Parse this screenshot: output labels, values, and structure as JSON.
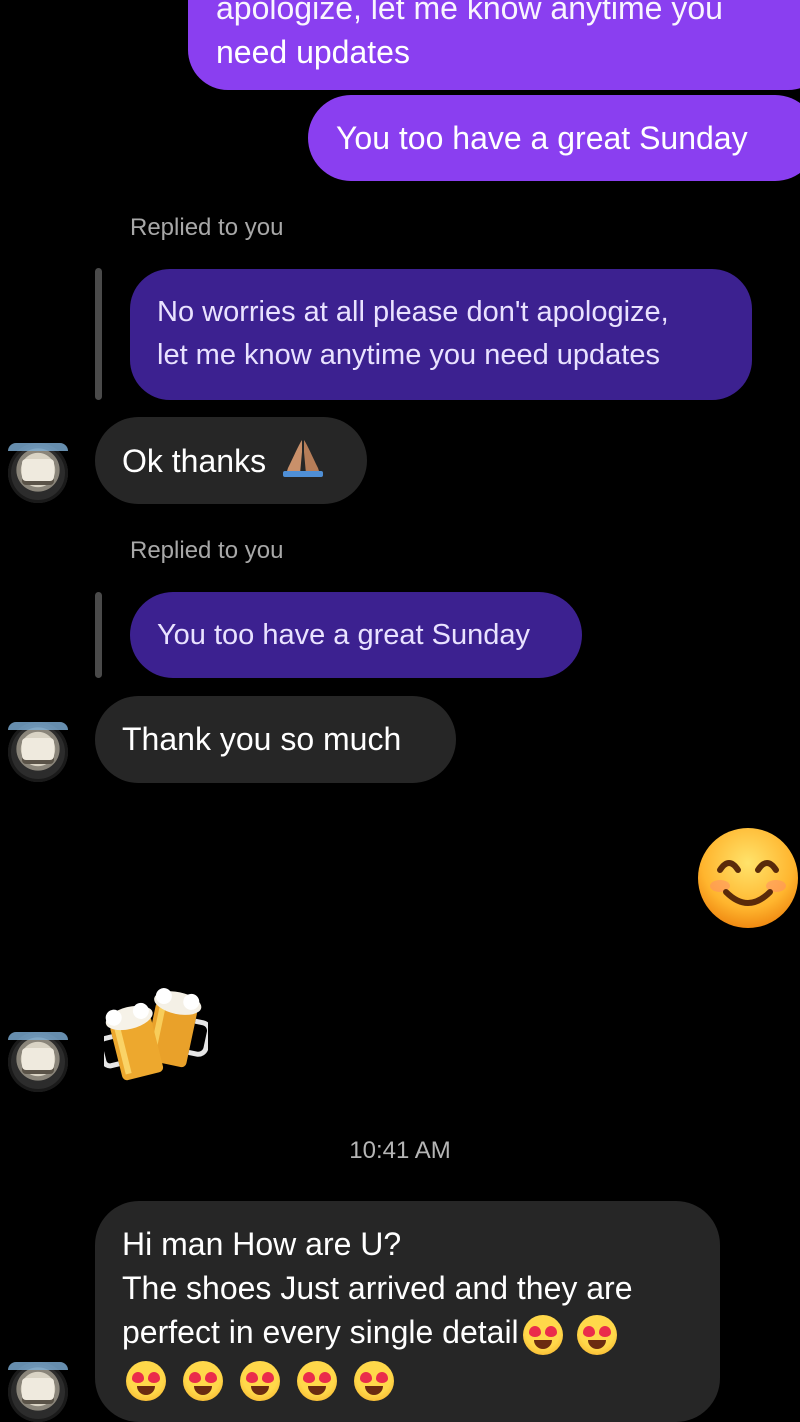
{
  "outgoing": {
    "top_partial_line": "apologize, let me know anytime you",
    "top_line2": "need updates",
    "sunday": "You too have a great Sunday"
  },
  "replies": [
    {
      "label": "Replied to you",
      "quote_line1": "No worries at all please don't apologize,",
      "quote_line2": "let me know anytime you need updates",
      "message": "Ok thanks",
      "message_emoji": "folded-hands"
    },
    {
      "label": "Replied to you",
      "quote_line1": "You too have a great Sunday",
      "message": "Thank you so much"
    }
  ],
  "outgoing_emoji": "smiling-face-with-smiling-eyes",
  "incoming_emoji": "clinking-beer-mugs",
  "timestamp": "10:41 AM",
  "last_message": {
    "line1": "Hi man How are U?",
    "line2": "The shoes Just arrived and they are",
    "line3": "perfect in every single detail",
    "emojis": [
      "heart-eyes",
      "heart-eyes",
      "heart-eyes",
      "heart-eyes",
      "heart-eyes",
      "heart-eyes",
      "heart-eyes"
    ]
  },
  "colors": {
    "background": "#000000",
    "outgoing_bubble": "#8a3ff0",
    "quoted_bubble": "#3c2190",
    "incoming_bubble": "#262626"
  }
}
